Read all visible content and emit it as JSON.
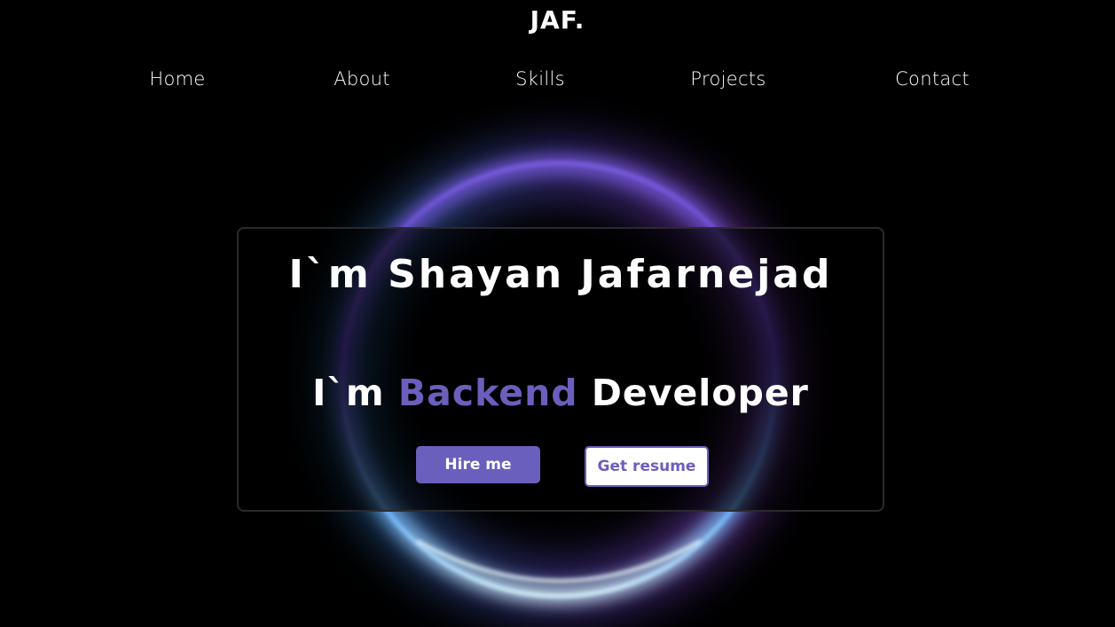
{
  "logo": {
    "text": "JAF."
  },
  "nav": {
    "items": [
      {
        "label": "Home"
      },
      {
        "label": "About"
      },
      {
        "label": "Skills"
      },
      {
        "label": "Projects"
      },
      {
        "label": "Contact"
      }
    ]
  },
  "hero": {
    "title": "I`m Shayan Jafarnejad",
    "role_prefix": "I`m",
    "role_accent": "Backend",
    "role_suffix": "Developer",
    "hire_button": "Hire me",
    "resume_button": "Get resume"
  },
  "colors": {
    "background": "#000000",
    "accent": "#6b5fbd",
    "text": "#ffffff",
    "ring_purple": "#8a4fe0",
    "ring_blue": "#4a7fd8",
    "ring_cyan": "#9fe4ff"
  }
}
